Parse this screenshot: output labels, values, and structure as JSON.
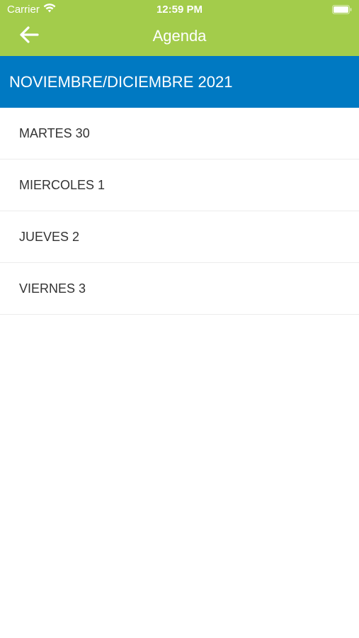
{
  "status_bar": {
    "carrier": "Carrier",
    "time": "12:59 PM"
  },
  "nav": {
    "title": "Agenda",
    "back_icon": "arrow-left-icon"
  },
  "section": {
    "title": "NOVIEMBRE/DICIEMBRE 2021"
  },
  "days": [
    {
      "label": "MARTES 30"
    },
    {
      "label": "MIERCOLES 1"
    },
    {
      "label": "JUEVES 2"
    },
    {
      "label": "VIERNES 3"
    }
  ],
  "colors": {
    "nav_background": "#a3cc4b",
    "section_background": "#0079c2",
    "text_primary": "#333333"
  }
}
